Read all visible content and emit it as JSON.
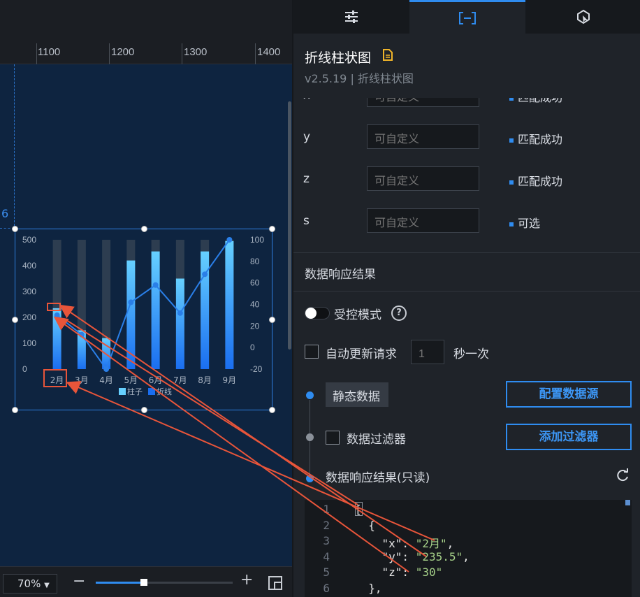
{
  "canvas": {
    "ruler_labels": [
      "1100",
      "1200",
      "1300",
      "1400"
    ],
    "guide_number": "6",
    "zoom": {
      "value": "70%",
      "level": 0.35
    }
  },
  "chart_data": {
    "type": "bar",
    "categories": [
      "2月",
      "3月",
      "4月",
      "5月",
      "6月",
      "7月",
      "8月",
      "9月"
    ],
    "series": [
      {
        "name": "柱子",
        "type": "bar",
        "values": [
          235.5,
          150,
          120,
          420,
          455,
          350,
          455,
          495
        ]
      },
      {
        "name": "折线",
        "type": "line",
        "axis": "right",
        "values": [
          30,
          12,
          -20,
          42,
          58,
          32,
          68,
          100
        ]
      }
    ],
    "yleft": {
      "ticks": [
        "500",
        "400",
        "300",
        "200",
        "100",
        "0"
      ],
      "range": [
        0,
        500
      ]
    },
    "yright": {
      "ticks": [
        "100",
        "80",
        "60",
        "40",
        "20",
        "0",
        "-20"
      ],
      "range": [
        -20,
        100
      ]
    },
    "legend": "bottom-center",
    "colors": {
      "bar_top": "#66d0ff",
      "bar_bottom": "#1a6ef0",
      "line": "#2a7fe8",
      "bg_bar": "#2d3d50"
    }
  },
  "panel": {
    "tabs": [
      {
        "name": "settings-tab",
        "icon": "sliders-icon"
      },
      {
        "name": "data-tab",
        "icon": "bracket-data-icon",
        "active": true
      },
      {
        "name": "interaction-tab",
        "icon": "cursor-shape-icon"
      }
    ],
    "title": "折线柱状图",
    "version": "v2.5.19 | 折线柱状图",
    "fields": [
      {
        "key": "x",
        "placeholder": "可自定义",
        "status": "匹配成功"
      },
      {
        "key": "y",
        "placeholder": "可自定义",
        "status": "匹配成功"
      },
      {
        "key": "z",
        "placeholder": "可自定义",
        "status": "匹配成功"
      },
      {
        "key": "s",
        "placeholder": "可自定义",
        "status": "可选"
      }
    ],
    "section_title": "数据响应结果",
    "controlled_mode": "受控模式",
    "help": "?",
    "auto_update": {
      "label": "自动更新请求",
      "value": "1",
      "unit": "秒一次"
    },
    "static_data": "静态数据",
    "config_source_btn": "配置数据源",
    "data_filter": "数据过滤器",
    "add_filter_btn": "添加过滤器",
    "result_readonly": "数据响应结果(只读)",
    "code": {
      "line_numbers": [
        "1",
        "2",
        "3",
        "4",
        "5",
        "6"
      ],
      "lines": [
        {
          "t": "["
        },
        {
          "t": "  {"
        },
        {
          "k": "    \"x\": ",
          "s": "\"2月\"",
          "e": ","
        },
        {
          "k": "    \"y\": ",
          "s": "\"235.5\"",
          "e": ","
        },
        {
          "k": "    \"z\": ",
          "s": "\"30\""
        },
        {
          "t": "  },"
        }
      ]
    }
  }
}
